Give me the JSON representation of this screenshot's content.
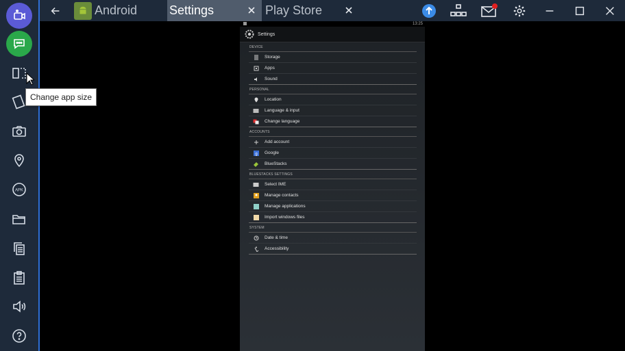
{
  "tabs": [
    {
      "label": "Android"
    },
    {
      "label": "Settings"
    },
    {
      "label": "Play Store"
    }
  ],
  "tooltip": "Change app size",
  "android": {
    "status_time": "13:25",
    "settings_title": "Settings",
    "sections": [
      {
        "header": "DEVICE",
        "items": [
          "Storage",
          "Apps",
          "Sound"
        ]
      },
      {
        "header": "PERSONAL",
        "items": [
          "Location",
          "Language & input",
          "Change language"
        ]
      },
      {
        "header": "ACCOUNTS",
        "items": [
          "Add account",
          "Google",
          "BlueStacks"
        ]
      },
      {
        "header": "BLUESTACKS SETTINGS",
        "items": [
          "Select IME",
          "Manage contacts",
          "Manage applications",
          "Import windows files"
        ]
      },
      {
        "header": "SYSTEM",
        "items": [
          "Date & time",
          "Accessibility"
        ]
      }
    ]
  },
  "colors": {
    "chrome_bg": "#1e2a3a",
    "active_tab": "#505c6c",
    "accent_blue": "#2f6fd6",
    "upload_blue": "#3b8be6",
    "notification_red": "#e02020"
  }
}
